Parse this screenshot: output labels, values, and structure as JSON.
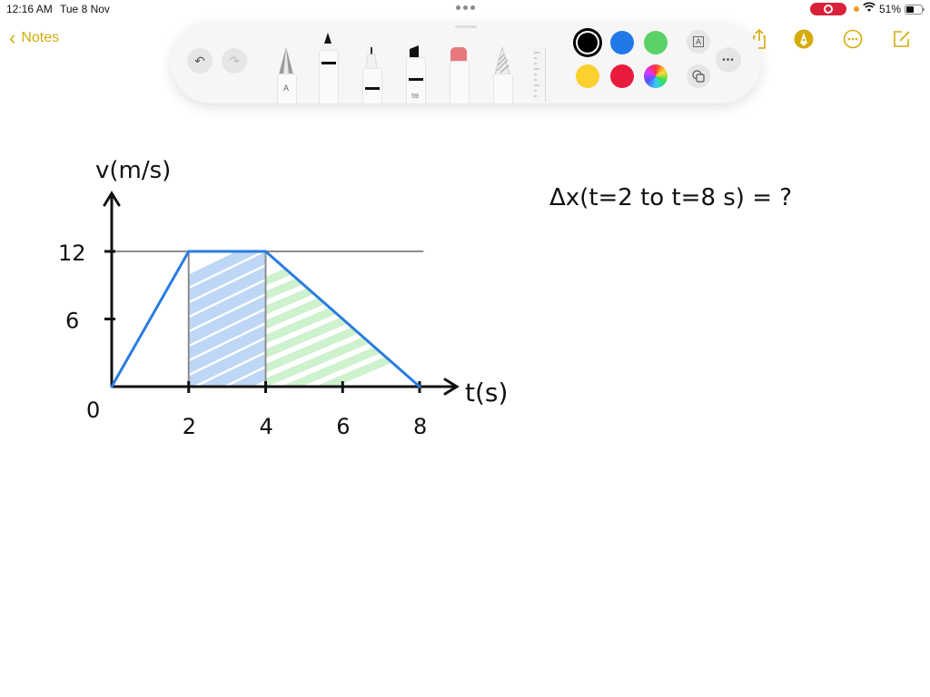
{
  "status_bar": {
    "time": "12:16 AM",
    "date": "Tue 8 Nov",
    "battery_percent": "51%",
    "battery_level": 0.51,
    "wifi_icon": "wifi-icon",
    "recording_icon": "screen-recording-icon"
  },
  "nav": {
    "back_label": "Notes",
    "back_icon": "chevron-left-icon",
    "share_icon": "share-icon",
    "markup_icon": "markup-pen-icon",
    "more_icon": "ellipsis-circle-icon",
    "compose_icon": "compose-icon"
  },
  "palette": {
    "undo_icon": "undo-icon",
    "redo_icon": "redo-icon",
    "tools": [
      {
        "name": "pen-tool",
        "label": "A"
      },
      {
        "name": "marker-tool",
        "label": ""
      },
      {
        "name": "fineliner-tool",
        "label": ""
      },
      {
        "name": "highlighter-tool",
        "label": "59"
      },
      {
        "name": "eraser-tool",
        "label": ""
      },
      {
        "name": "lasso-tool",
        "label": ""
      },
      {
        "name": "ruler-tool",
        "label": ""
      }
    ],
    "colors": [
      {
        "name": "black",
        "hex": "#000000",
        "selected": true
      },
      {
        "name": "blue",
        "hex": "#1f7ae8",
        "selected": false
      },
      {
        "name": "green",
        "hex": "#5ad267",
        "selected": false
      },
      {
        "name": "yellow",
        "hex": "#fbd02f",
        "selected": false
      },
      {
        "name": "red",
        "hex": "#e81b3c",
        "selected": false
      },
      {
        "name": "multicolor",
        "hex": "conic",
        "selected": false
      }
    ],
    "text_box_label": "A",
    "more_label": "•••"
  },
  "note": {
    "question": "Δx(t=2 to t=8 s) = ?"
  },
  "chart_data": {
    "type": "line",
    "title": "",
    "xlabel": "t(s)",
    "ylabel": "v(m/s)",
    "x_ticks": [
      2,
      4,
      6,
      8
    ],
    "x_tick_labels": [
      "2",
      "4",
      "6",
      "8"
    ],
    "y_ticks": [
      6,
      12
    ],
    "y_tick_labels": [
      "6",
      "12"
    ],
    "origin_label": "0",
    "xlim": [
      0,
      9
    ],
    "ylim": [
      0,
      17
    ],
    "series": [
      {
        "name": "velocity",
        "color": "#2a7de1",
        "x": [
          0,
          2,
          4,
          8
        ],
        "y": [
          0,
          12,
          12,
          0
        ]
      }
    ],
    "reference_lines": [
      {
        "type": "horizontal",
        "y": 12,
        "x_from": 0,
        "x_to": 8.1
      },
      {
        "type": "vertical",
        "x": 2,
        "y_from": 0,
        "y_to": 12
      },
      {
        "type": "vertical",
        "x": 4,
        "y_from": 0,
        "y_to": 12
      }
    ],
    "shaded_regions": [
      {
        "name": "blue-hatch",
        "color": "#b7d3f5",
        "x_from": 2,
        "x_to": 4,
        "polygon": [
          [
            2,
            0
          ],
          [
            2,
            12
          ],
          [
            4,
            12
          ],
          [
            4,
            0
          ]
        ]
      },
      {
        "name": "green-hatch",
        "color": "#c9f0c9",
        "x_from": 4,
        "x_to": 8,
        "polygon": [
          [
            4,
            0
          ],
          [
            4,
            12
          ],
          [
            8,
            0
          ]
        ]
      }
    ]
  }
}
